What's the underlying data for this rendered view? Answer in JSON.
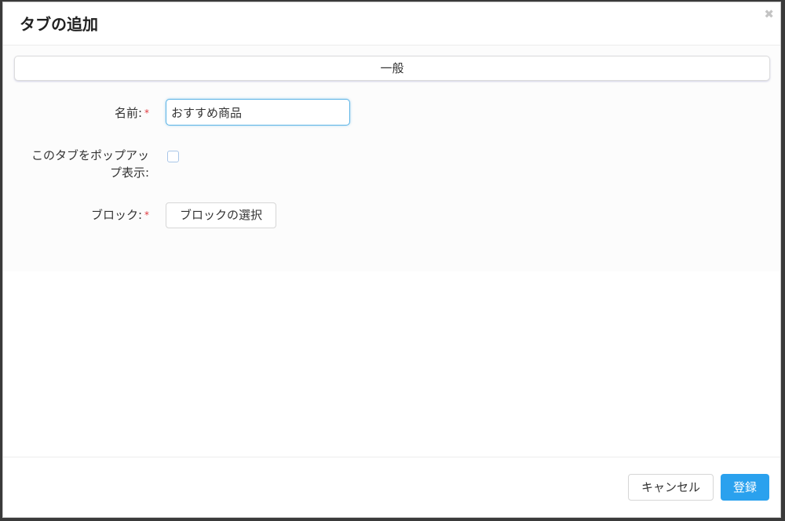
{
  "dialog": {
    "title": "タブの追加",
    "close_icon": "close-icon",
    "close_symbol": "✖"
  },
  "section": {
    "tab_label": "一般"
  },
  "form": {
    "name": {
      "label": "名前:",
      "required_mark": "*",
      "value": "おすすめ商品"
    },
    "popup": {
      "label_line1": "このタブをポップアッ",
      "label_line2": "プ表示:",
      "checked": false
    },
    "block": {
      "label": "ブロック:",
      "required_mark": "*",
      "button_label": "ブロックの選択"
    }
  },
  "footer": {
    "cancel_label": "キャンセル",
    "save_label": "登録"
  },
  "colors": {
    "primary": "#2aa1ee",
    "required": "#e0383e",
    "input_focus": "#5bb3e6"
  }
}
